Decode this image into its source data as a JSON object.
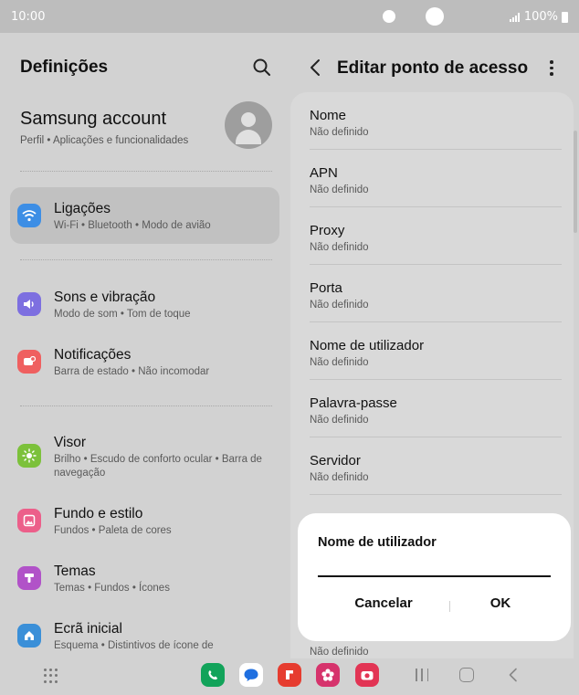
{
  "status_bar": {
    "time": "10:00",
    "battery": "100%"
  },
  "left_pane": {
    "title": "Definições",
    "account": {
      "name": "Samsung account",
      "subtitle": "Perfil  •  Aplicações e funcionalidades"
    },
    "items": [
      {
        "title": "Ligações",
        "subtitle": "Wi-Fi  •  Bluetooth  •  Modo de avião",
        "icon": "wifi-icon",
        "color": "#3d8ee5",
        "active": true
      },
      {
        "title": "Sons e vibração",
        "subtitle": "Modo de som  •  Tom de toque",
        "icon": "volume-icon",
        "color": "#7d6fe0",
        "active": false
      },
      {
        "title": "Notificações",
        "subtitle": "Barra de estado  •  Não incomodar",
        "icon": "notification-icon",
        "color": "#ef6060",
        "active": false
      },
      {
        "title": "Visor",
        "subtitle": "Brilho  •  Escudo de conforto ocular  •  Barra de navegação",
        "icon": "brightness-icon",
        "color": "#7cc13b",
        "active": false
      },
      {
        "title": "Fundo e estilo",
        "subtitle": "Fundos  •  Paleta de cores",
        "icon": "wallpaper-icon",
        "color": "#ec5f8a",
        "active": false
      },
      {
        "title": "Temas",
        "subtitle": "Temas  •  Fundos  •  Ícones",
        "icon": "themes-icon",
        "color": "#b152c8",
        "active": false
      },
      {
        "title": "Ecrã inicial",
        "subtitle": "Esquema  •  Distintivos de ícone de",
        "icon": "home-icon",
        "color": "#3a8fd8",
        "active": false
      }
    ]
  },
  "right_pane": {
    "title": "Editar ponto de acesso",
    "fields": [
      {
        "label": "Nome",
        "value": "Não definido"
      },
      {
        "label": "APN",
        "value": "Não definido"
      },
      {
        "label": "Proxy",
        "value": "Não definido"
      },
      {
        "label": "Porta",
        "value": "Não definido"
      },
      {
        "label": "Nome de utilizador",
        "value": "Não definido"
      },
      {
        "label": "Palavra-passe",
        "value": "Não definido"
      },
      {
        "label": "Servidor",
        "value": "Não definido"
      }
    ],
    "peek_value": "Não definido"
  },
  "dialog": {
    "title": "Nome de utilizador",
    "input_value": "",
    "cancel_label": "Cancelar",
    "ok_label": "OK"
  },
  "dock": {
    "apps": [
      {
        "icon": "phone-app-icon",
        "color": "#12a35a"
      },
      {
        "icon": "messages-app-icon",
        "color": "#1f6fe0"
      },
      {
        "icon": "flipboard-app-icon",
        "color": "#e63c2f"
      },
      {
        "icon": "gallery-app-icon",
        "color": "#d6336c"
      },
      {
        "icon": "camera-app-icon",
        "color": "#e23454"
      }
    ]
  }
}
